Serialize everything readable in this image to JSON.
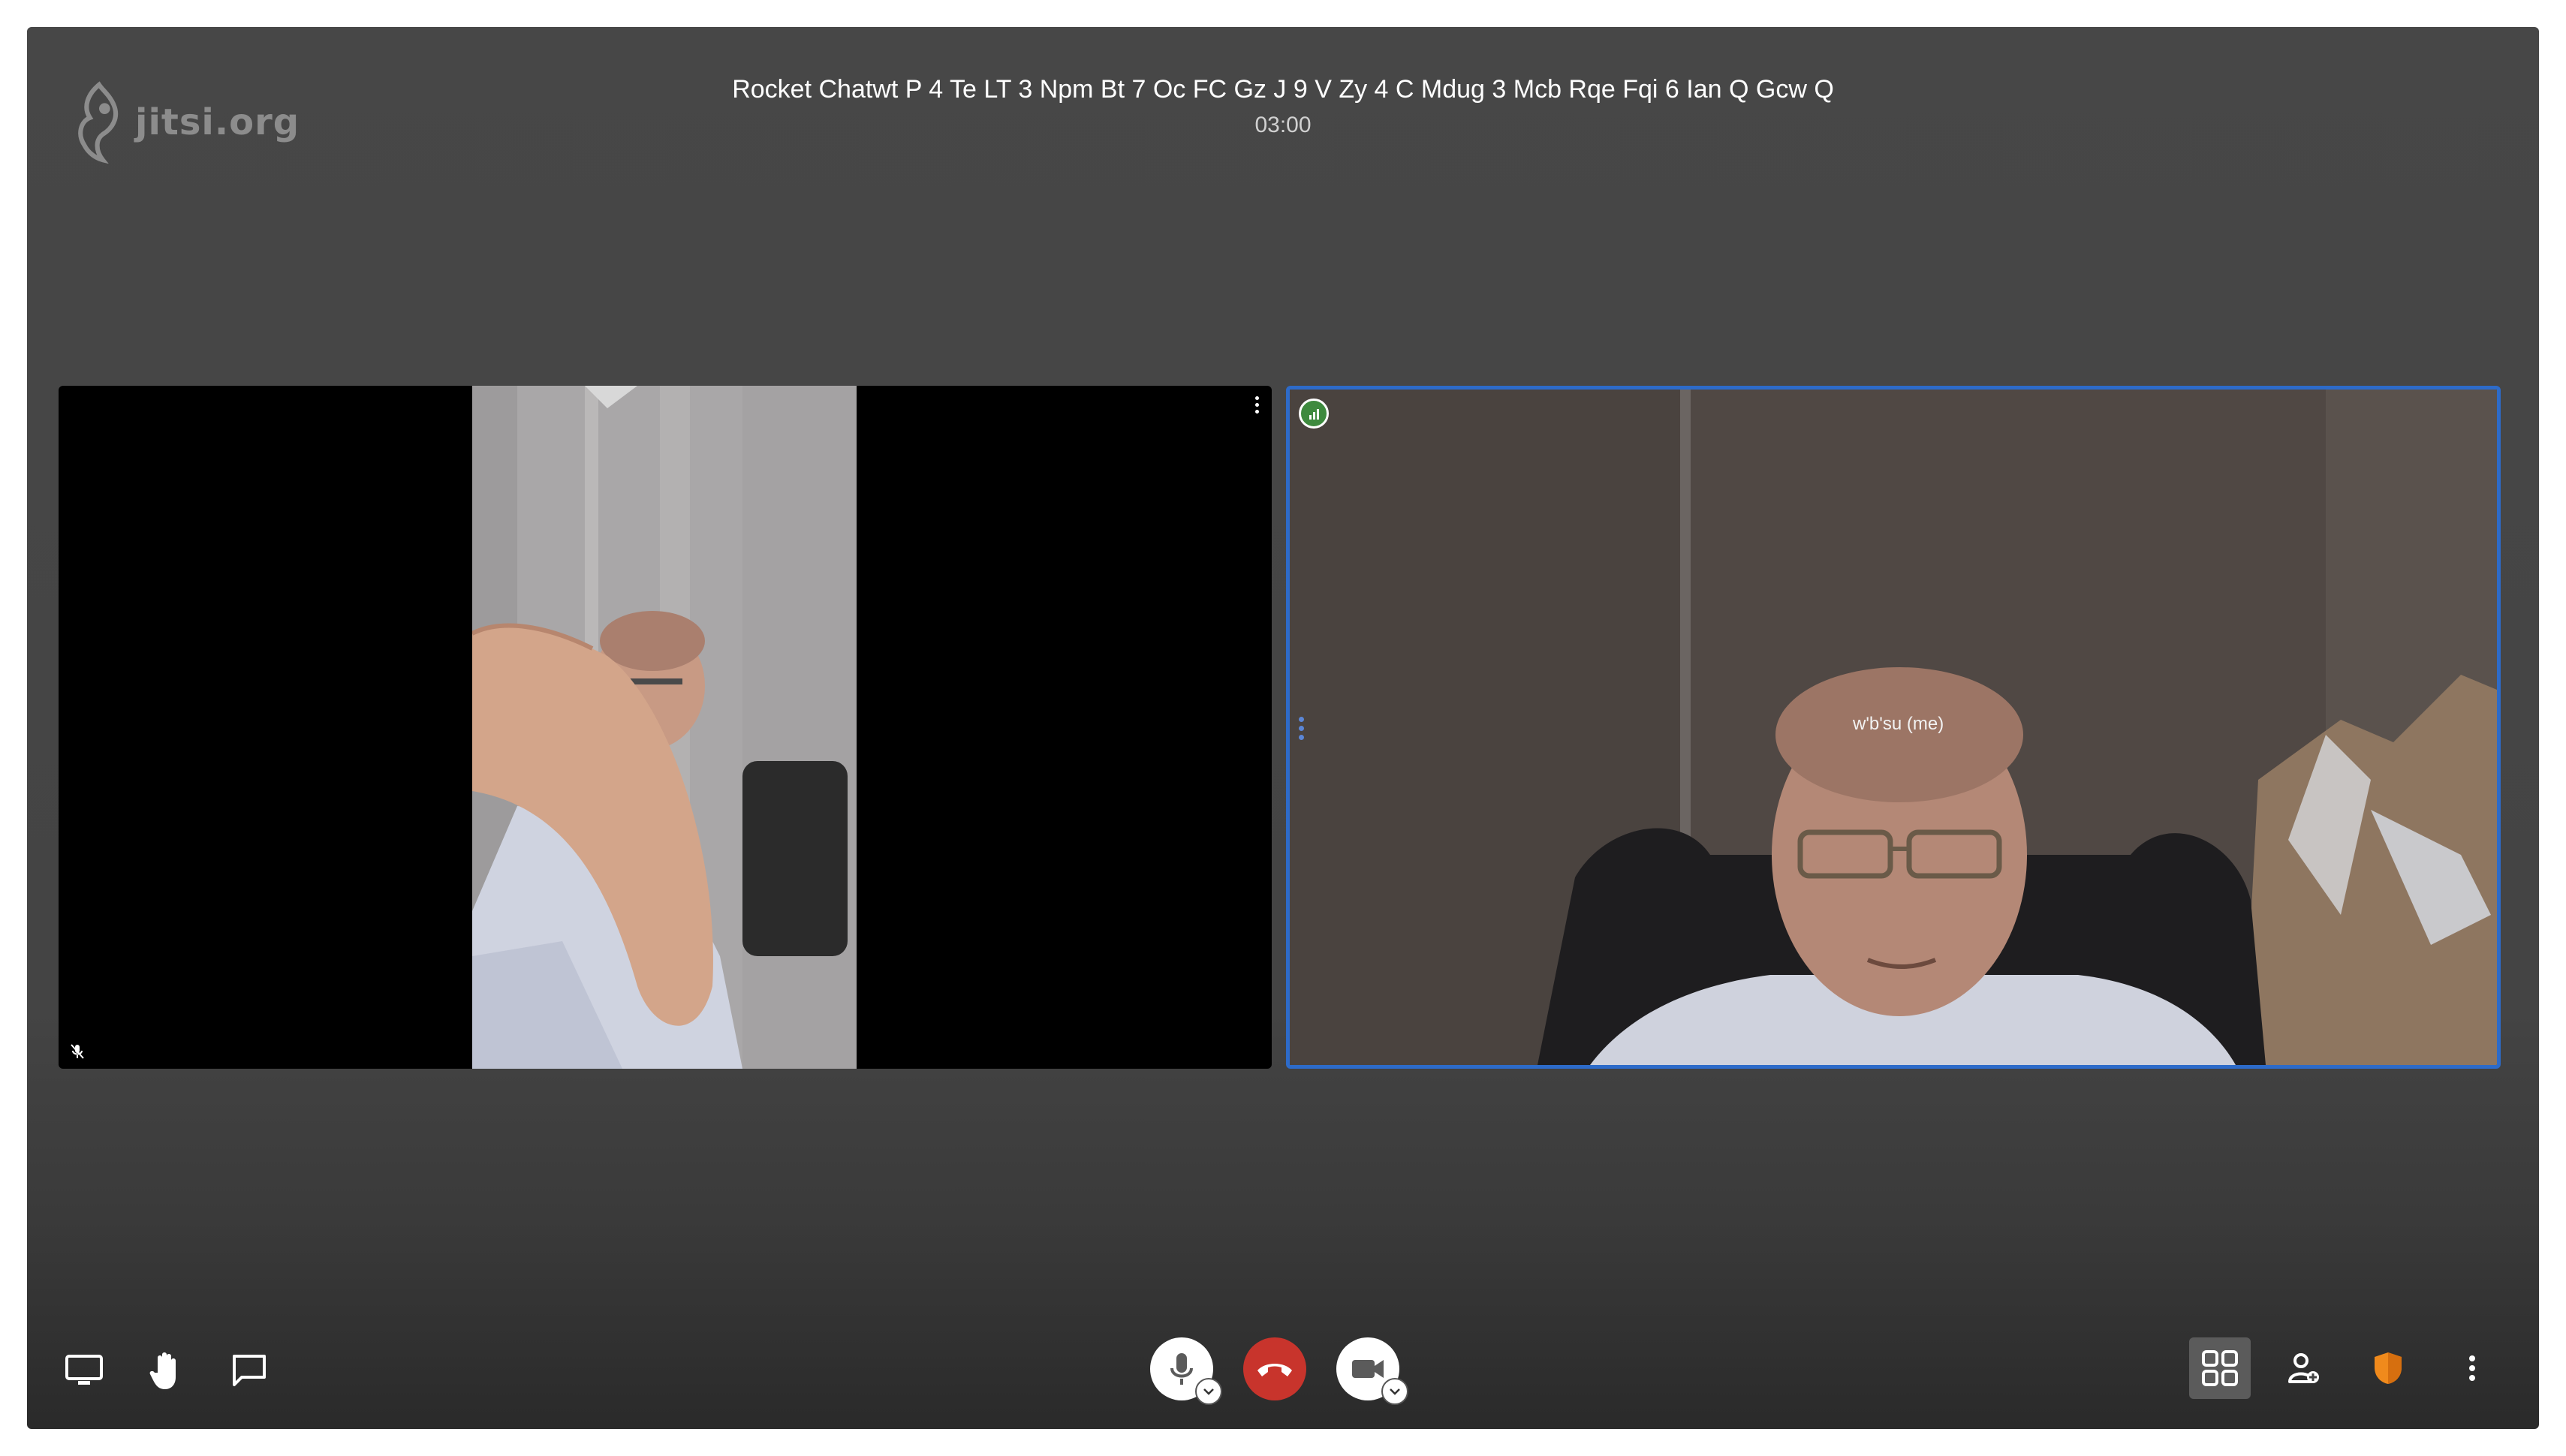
{
  "header": {
    "logo_text": "jitsi.org",
    "meeting_title": "Rocket Chatwt P 4 Te LT 3 Npm Bt 7 Oc FC Gz J 9 V Zy 4 C Mdug 3 Mcb Rqe Fqi 6 Ian Q Gcw Q",
    "timer": "03:00"
  },
  "tiles": {
    "local": {
      "display_name": "w'b'su (me)"
    }
  },
  "toolbar": {
    "left": [
      "screen-share",
      "raise-hand",
      "chat"
    ],
    "center": [
      "microphone",
      "hangup",
      "camera"
    ],
    "right": [
      "tile-view",
      "invite-people",
      "security-options",
      "more-actions"
    ]
  },
  "colors": {
    "active_speaker_border": "#2d6bc9",
    "hangup": "#c8342c",
    "security_shield": "#f08a1c",
    "connection_good": "#3e8a3e"
  }
}
